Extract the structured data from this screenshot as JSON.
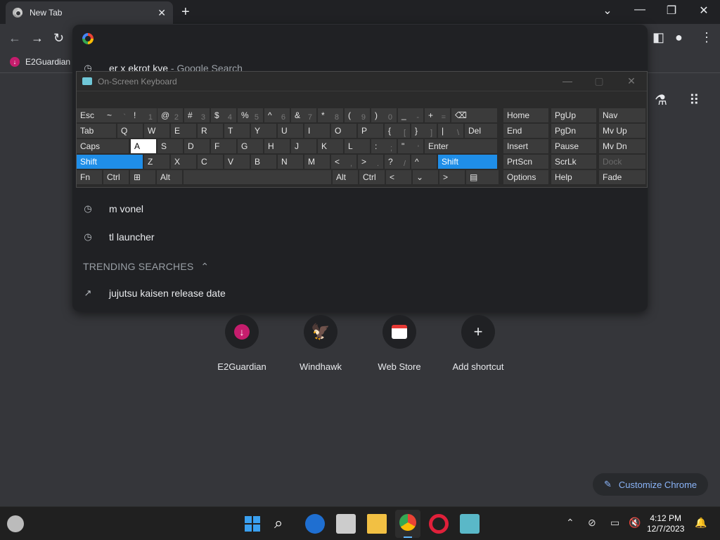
{
  "browser": {
    "tab_title": "New Tab",
    "bookmark_label": "E2Guardian"
  },
  "omnibox": {
    "suggestions": [
      {
        "text": "er x ekrot kve",
        "suffix": " - Google Search"
      },
      {
        "text": "m vonel",
        "suffix": ""
      },
      {
        "text": "tl launcher",
        "suffix": ""
      }
    ],
    "trending_header": "TRENDING SEARCHES",
    "trending": [
      "jujutsu kaisen release date"
    ]
  },
  "shortcuts": [
    "E2Guardian",
    "Windhawk",
    "Web Store",
    "Add shortcut"
  ],
  "customize_label": "Customize Chrome",
  "osk": {
    "title": "On-Screen Keyboard",
    "row1": [
      {
        "l": "Esc"
      },
      {
        "l": "~",
        "s": "`"
      },
      {
        "l": "!",
        "s": "1"
      },
      {
        "l": "@",
        "s": "2"
      },
      {
        "l": "#",
        "s": "3"
      },
      {
        "l": "$",
        "s": "4"
      },
      {
        "l": "%",
        "s": "5"
      },
      {
        "l": "^",
        "s": "6"
      },
      {
        "l": "&",
        "s": "7"
      },
      {
        "l": "*",
        "s": "8"
      },
      {
        "l": "(",
        "s": "9"
      },
      {
        "l": ")",
        "s": "0"
      },
      {
        "l": "_",
        "s": "-"
      },
      {
        "l": "+",
        "s": "="
      },
      {
        "l": "⌫"
      },
      {
        "l": "Home"
      },
      {
        "l": "PgUp"
      },
      {
        "l": "Nav"
      }
    ],
    "row2": [
      {
        "l": "Tab"
      },
      {
        "l": "Q"
      },
      {
        "l": "W"
      },
      {
        "l": "E"
      },
      {
        "l": "R"
      },
      {
        "l": "T"
      },
      {
        "l": "Y"
      },
      {
        "l": "U"
      },
      {
        "l": "I"
      },
      {
        "l": "O"
      },
      {
        "l": "P"
      },
      {
        "l": "{",
        "s": "["
      },
      {
        "l": "}",
        "s": "]"
      },
      {
        "l": "|",
        "s": "\\"
      },
      {
        "l": "Del"
      },
      {
        "l": "End"
      },
      {
        "l": "PgDn"
      },
      {
        "l": "Mv Up"
      }
    ],
    "row3": [
      {
        "l": "Caps"
      },
      {
        "l": "A"
      },
      {
        "l": "S"
      },
      {
        "l": "D"
      },
      {
        "l": "F"
      },
      {
        "l": "G"
      },
      {
        "l": "H"
      },
      {
        "l": "J"
      },
      {
        "l": "K"
      },
      {
        "l": "L"
      },
      {
        "l": ":",
        "s": ";"
      },
      {
        "l": "\"",
        "s": "'"
      },
      {
        "l": "Enter"
      },
      {
        "l": "Insert"
      },
      {
        "l": "Pause"
      },
      {
        "l": "Mv Dn"
      }
    ],
    "row4": [
      {
        "l": "Shift"
      },
      {
        "l": "Z"
      },
      {
        "l": "X"
      },
      {
        "l": "C"
      },
      {
        "l": "V"
      },
      {
        "l": "B"
      },
      {
        "l": "N"
      },
      {
        "l": "M"
      },
      {
        "l": "<",
        "s": ","
      },
      {
        "l": ">",
        "s": "."
      },
      {
        "l": "?",
        "s": "/"
      },
      {
        "l": "^"
      },
      {
        "l": "Shift"
      },
      {
        "l": "PrtScn"
      },
      {
        "l": "ScrLk"
      },
      {
        "l": "Dock"
      }
    ],
    "row5": [
      {
        "l": "Fn"
      },
      {
        "l": "Ctrl"
      },
      {
        "l": "⊞"
      },
      {
        "l": "Alt"
      },
      {
        "l": ""
      },
      {
        "l": "Alt"
      },
      {
        "l": "Ctrl"
      },
      {
        "l": "<"
      },
      {
        "l": "⌄"
      },
      {
        "l": ">"
      },
      {
        "l": "▤"
      },
      {
        "l": "Options"
      },
      {
        "l": "Help"
      },
      {
        "l": "Fade"
      }
    ]
  },
  "taskbar": {
    "time": "4:12 PM",
    "date": "12/7/2023"
  }
}
